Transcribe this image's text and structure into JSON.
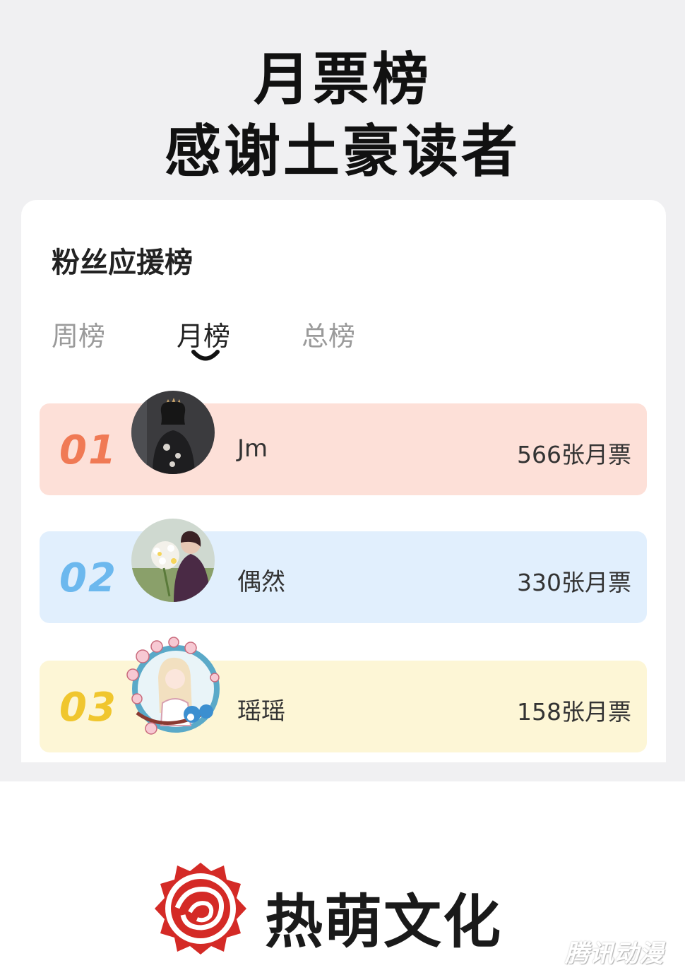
{
  "header": {
    "line1": "月票榜",
    "line2": "感谢土豪读者"
  },
  "card": {
    "title": "粉丝应援榜",
    "tabs": [
      {
        "label": "周榜",
        "active": false
      },
      {
        "label": "月榜",
        "active": true
      },
      {
        "label": "总榜",
        "active": false
      }
    ]
  },
  "ranking": [
    {
      "rank": "01",
      "name": "Jm",
      "votes": "566张月票",
      "row_color": "#fde0d8",
      "rank_color": "#f07a55"
    },
    {
      "rank": "02",
      "name": "偶然",
      "votes": "330张月票",
      "row_color": "#e1effd",
      "rank_color": "#6cb8ee"
    },
    {
      "rank": "03",
      "name": "瑶瑶",
      "votes": "158张月票",
      "row_color": "#fdf6d6",
      "rank_color": "#f0c62e"
    }
  ],
  "brand": {
    "name": "热萌文化",
    "logo_color": "#d42a26",
    "watermark": "腾讯动漫"
  }
}
